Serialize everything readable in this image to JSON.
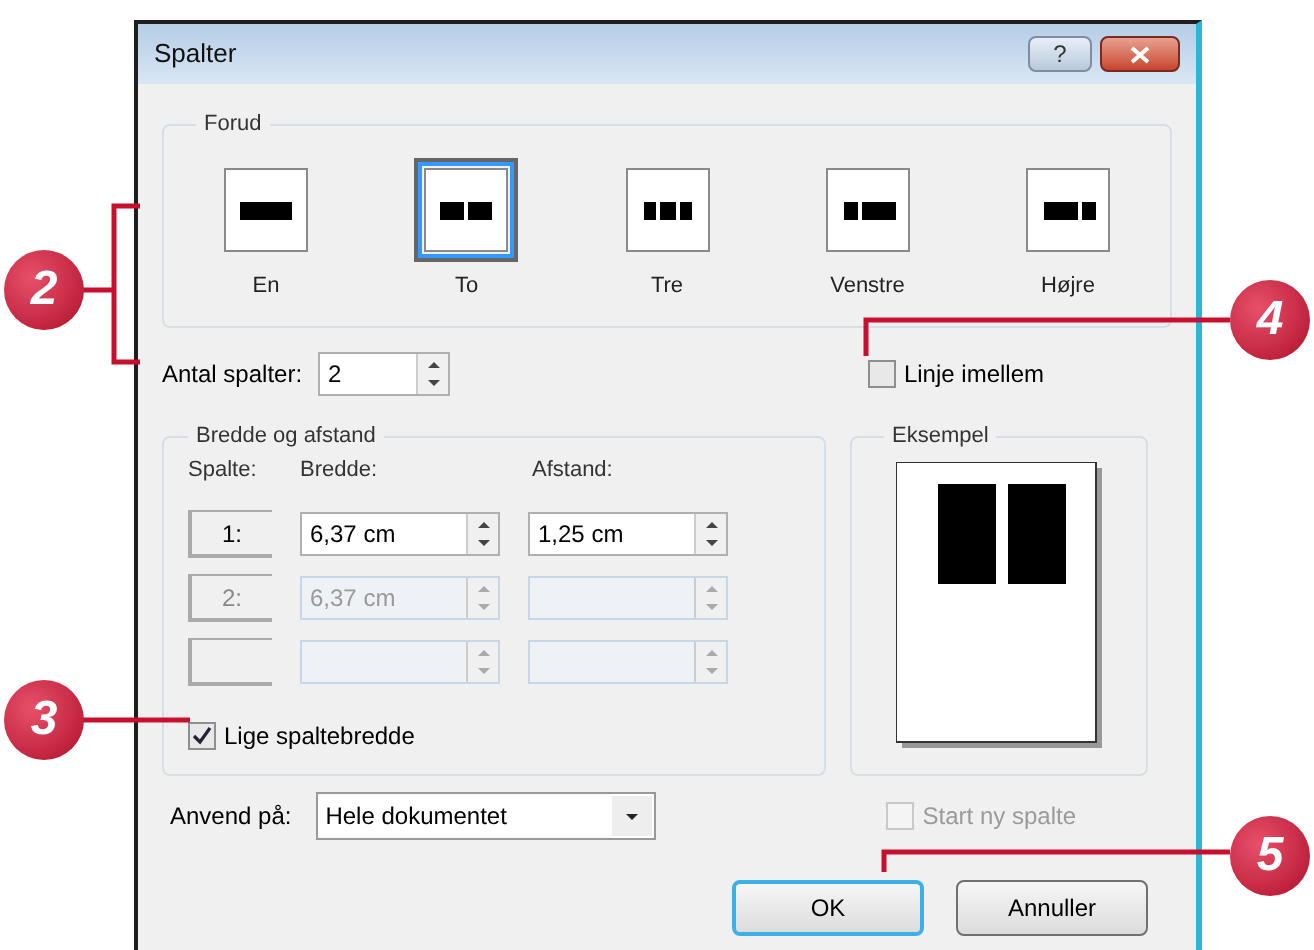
{
  "window": {
    "title": "Spalter",
    "help_button": "?"
  },
  "presets": {
    "label": "Forud",
    "items": [
      {
        "label": "En",
        "kind": "one",
        "selected": false
      },
      {
        "label": "To",
        "kind": "two",
        "selected": true
      },
      {
        "label": "Tre",
        "kind": "three",
        "selected": false
      },
      {
        "label": "Venstre",
        "kind": "left",
        "selected": false
      },
      {
        "label": "Højre",
        "kind": "right",
        "selected": false
      }
    ]
  },
  "column_count": {
    "label": "Antal spalter:",
    "value": "2"
  },
  "line_between": {
    "label": "Linje imellem",
    "checked": false
  },
  "width_spacing": {
    "label": "Bredde og afstand",
    "headers": [
      "Spalte:",
      "Bredde:",
      "Afstand:"
    ],
    "rows": [
      {
        "number": "1:",
        "width": "6,37 cm",
        "spacing": "1,25 cm",
        "disabled": false
      },
      {
        "number": "2:",
        "width": "6,37 cm",
        "disabled": true
      },
      {
        "disabled": true
      }
    ]
  },
  "equal_width": {
    "label": "Lige spaltebredde",
    "checked": true
  },
  "preview": {
    "label": "Eksempel"
  },
  "apply_to": {
    "label": "Anvend på:",
    "value": "Hele dokumentet"
  },
  "start_new_column": {
    "label": "Start ny spalte",
    "checked": false,
    "disabled": true
  },
  "buttons": [
    {
      "label": "OK",
      "default": true
    },
    {
      "label": "Annuller",
      "default": false
    }
  ],
  "callouts": [
    {
      "number": "2"
    },
    {
      "number": "3"
    },
    {
      "number": "4"
    },
    {
      "number": "5"
    }
  ]
}
